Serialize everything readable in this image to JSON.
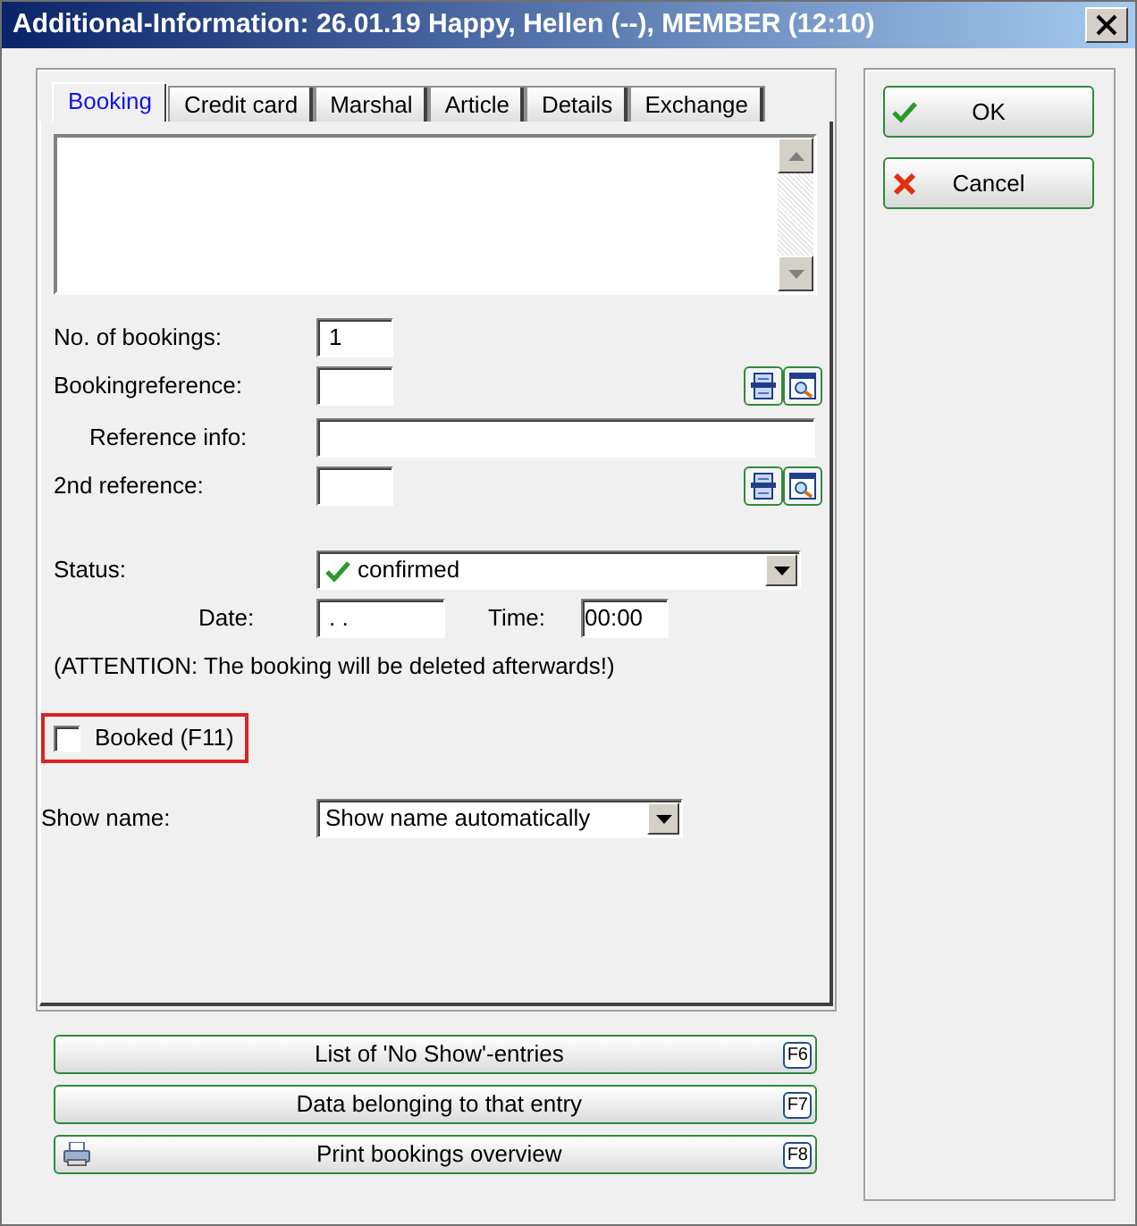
{
  "window": {
    "title": "Additional-Information: 26.01.19 Happy, Hellen (--), MEMBER (12:10)"
  },
  "tabs": [
    {
      "label": "Booking",
      "selected": true
    },
    {
      "label": "Credit card",
      "selected": false
    },
    {
      "label": "Marshal",
      "selected": false
    },
    {
      "label": "Article",
      "selected": false
    },
    {
      "label": "Details",
      "selected": false
    },
    {
      "label": "Exchange",
      "selected": false
    }
  ],
  "booking": {
    "no_of_bookings": {
      "label": "No. of bookings:",
      "value": "1"
    },
    "booking_reference": {
      "label": "Bookingreference:"
    },
    "reference_info": {
      "label": "Reference info:"
    },
    "second_reference": {
      "label": "2nd reference:"
    },
    "status": {
      "label": "Status:",
      "value": "confirmed"
    },
    "date": {
      "label": "Date:",
      "value": ". ."
    },
    "time": {
      "label": "Time:",
      "value": "00:00"
    },
    "attention": "(ATTENTION: The booking will be deleted afterwards!)",
    "booked": {
      "label": "Booked (F11)",
      "checked": false,
      "highlighted": true
    },
    "show_name": {
      "label": "Show name:",
      "value": "Show name automatically"
    }
  },
  "actions": [
    {
      "label": "List of 'No Show'-entries",
      "shortcut": "F6",
      "kind": "plain"
    },
    {
      "label": "Data belonging to that entry",
      "shortcut": "F7",
      "kind": "plain"
    },
    {
      "label": "Print bookings overview",
      "shortcut": "F8",
      "kind": "print"
    }
  ],
  "buttons": [
    {
      "label": "OK",
      "kind": "ok"
    },
    {
      "label": "Cancel",
      "kind": "cancel"
    }
  ]
}
